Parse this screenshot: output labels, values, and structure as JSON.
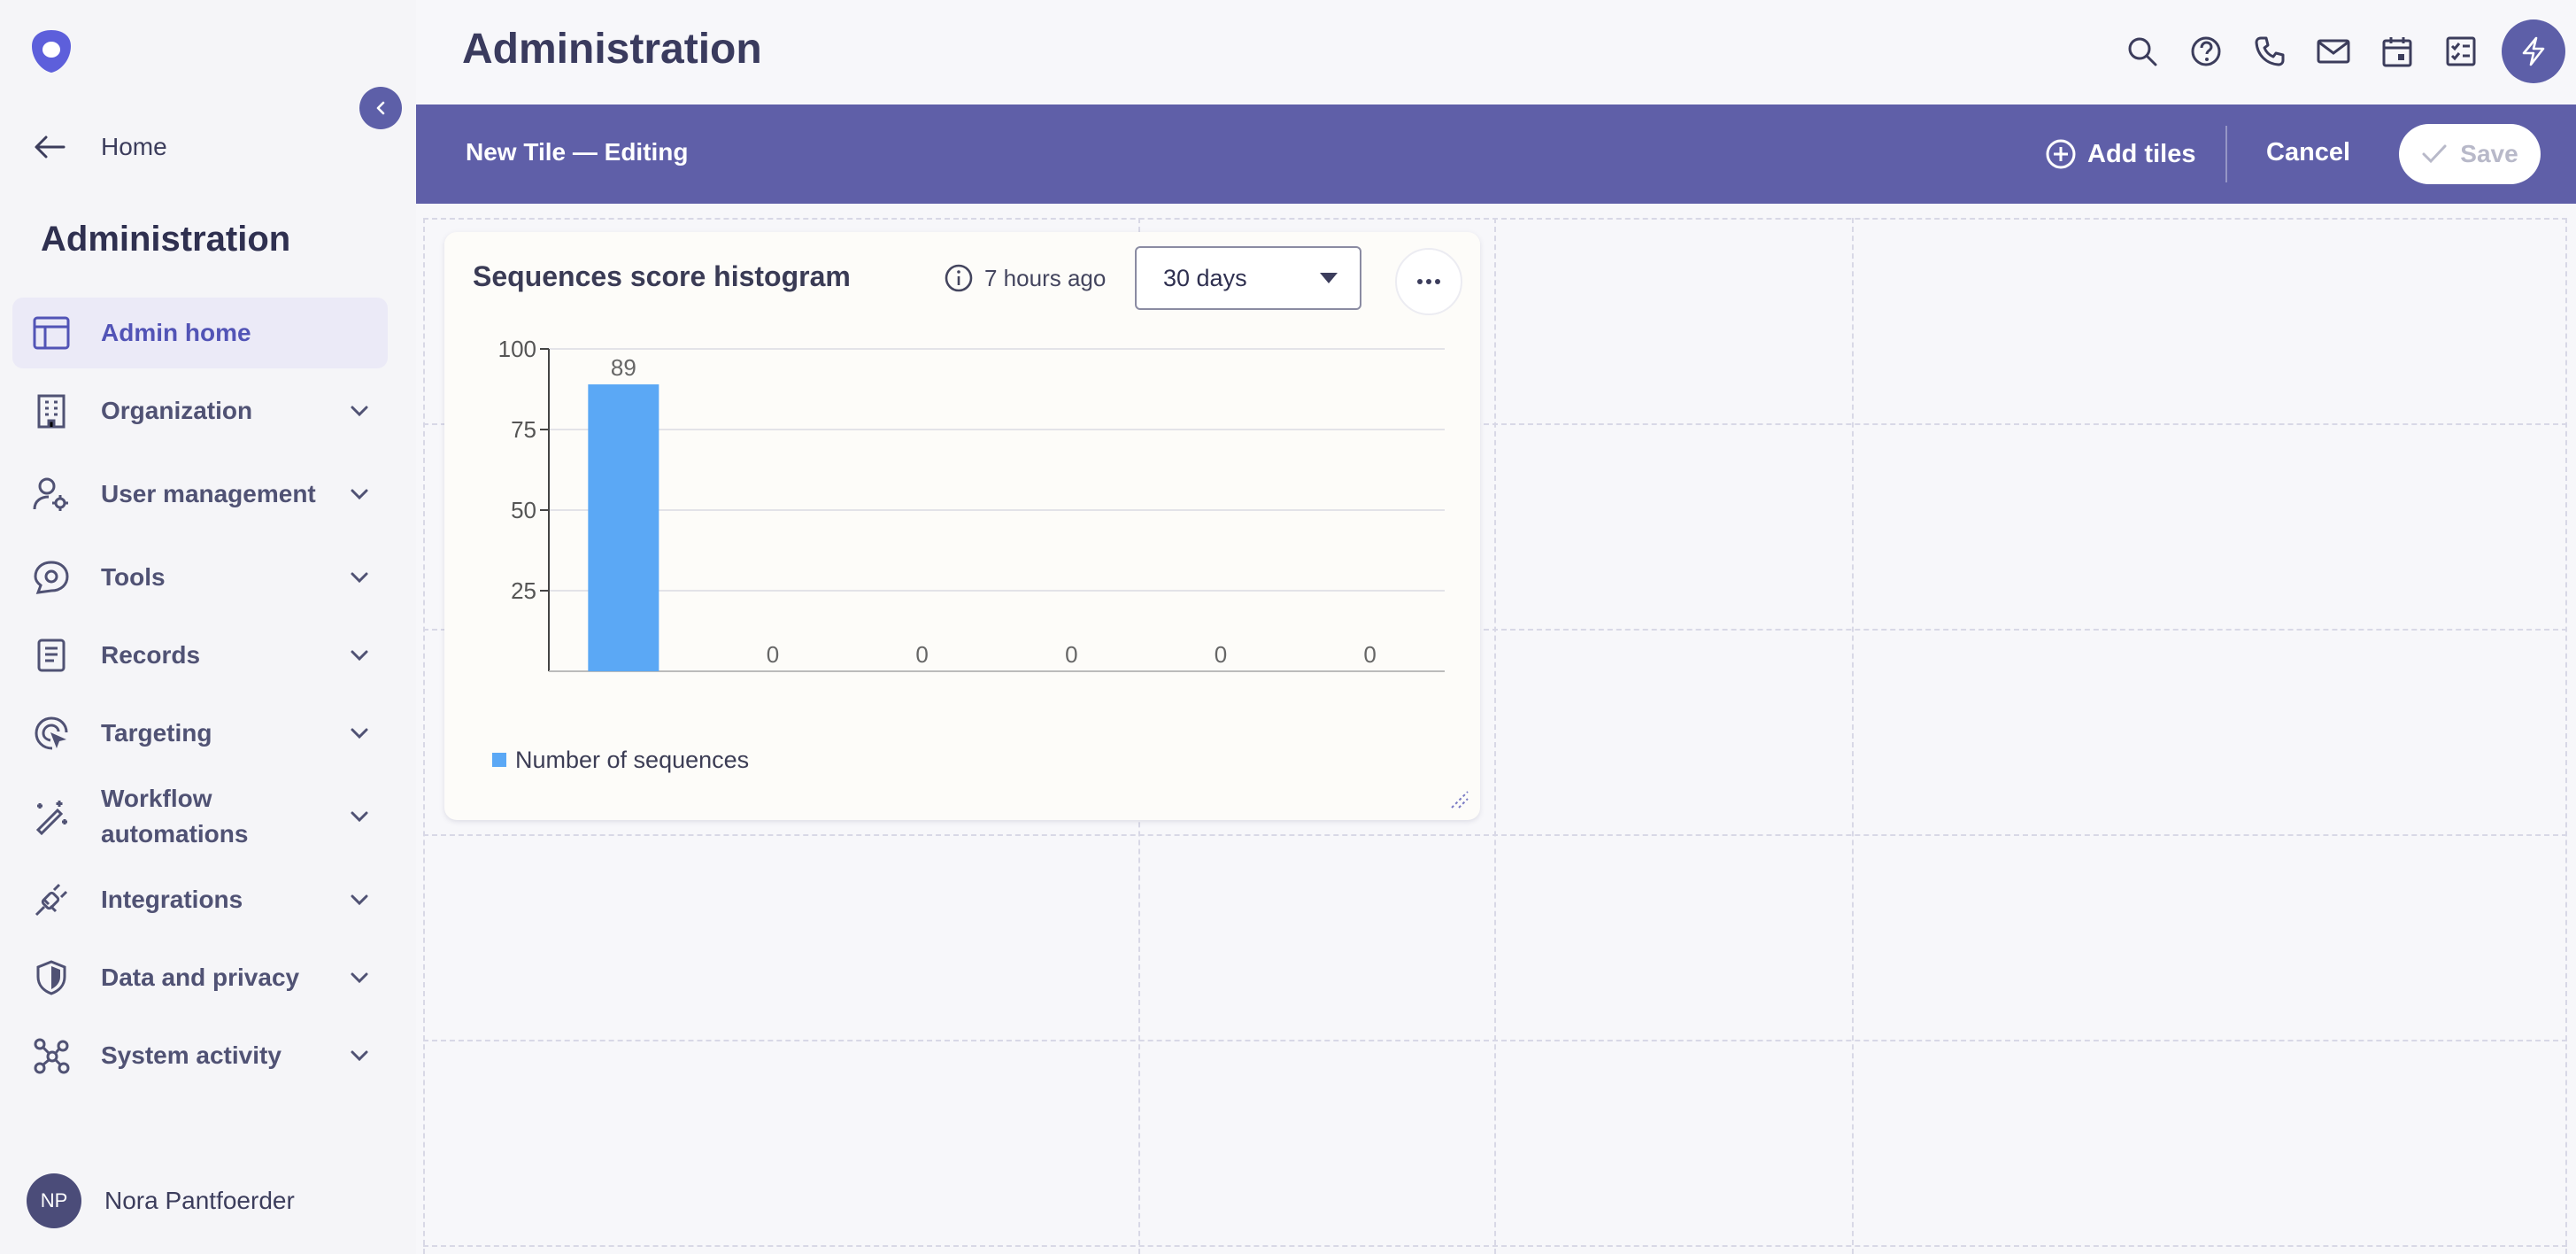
{
  "app": {
    "title": "Administration"
  },
  "sidebar": {
    "home_label": "Home",
    "heading": "Administration",
    "items": [
      {
        "label": "Admin home",
        "icon": "layout-icon",
        "active": true
      },
      {
        "label": "Organization",
        "icon": "building-icon"
      },
      {
        "label": "User management",
        "icon": "user-gear-icon"
      },
      {
        "label": "Tools",
        "icon": "tools-icon"
      },
      {
        "label": "Records",
        "icon": "records-icon"
      },
      {
        "label": "Targeting",
        "icon": "targeting-icon"
      },
      {
        "label": "Workflow automations",
        "icon": "magic-wand-icon"
      },
      {
        "label": "Integrations",
        "icon": "plug-icon"
      },
      {
        "label": "Data and privacy",
        "icon": "shield-icon"
      },
      {
        "label": "System activity",
        "icon": "network-icon"
      }
    ],
    "user": {
      "initials": "NP",
      "name": "Nora Pantfoerder"
    }
  },
  "editbar": {
    "title": "New Tile — Editing",
    "add_tiles_label": "Add tiles",
    "cancel_label": "Cancel",
    "save_label": "Save"
  },
  "tile": {
    "title": "Sequences score histogram",
    "updated": "7 hours ago",
    "range_selected": "30 days"
  },
  "colors": {
    "accent": "#5f5fa8",
    "bar": "#5ba8f5"
  },
  "chart_data": {
    "type": "bar",
    "categories": [
      "",
      "",
      "",
      "",
      "",
      ""
    ],
    "series": [
      {
        "name": "Number of sequences",
        "values": [
          89,
          0,
          0,
          0,
          0,
          0
        ]
      }
    ],
    "yticks": [
      25,
      50,
      75,
      100
    ],
    "ylim": [
      0,
      100
    ],
    "grid": true,
    "legend": "bottom-left"
  }
}
